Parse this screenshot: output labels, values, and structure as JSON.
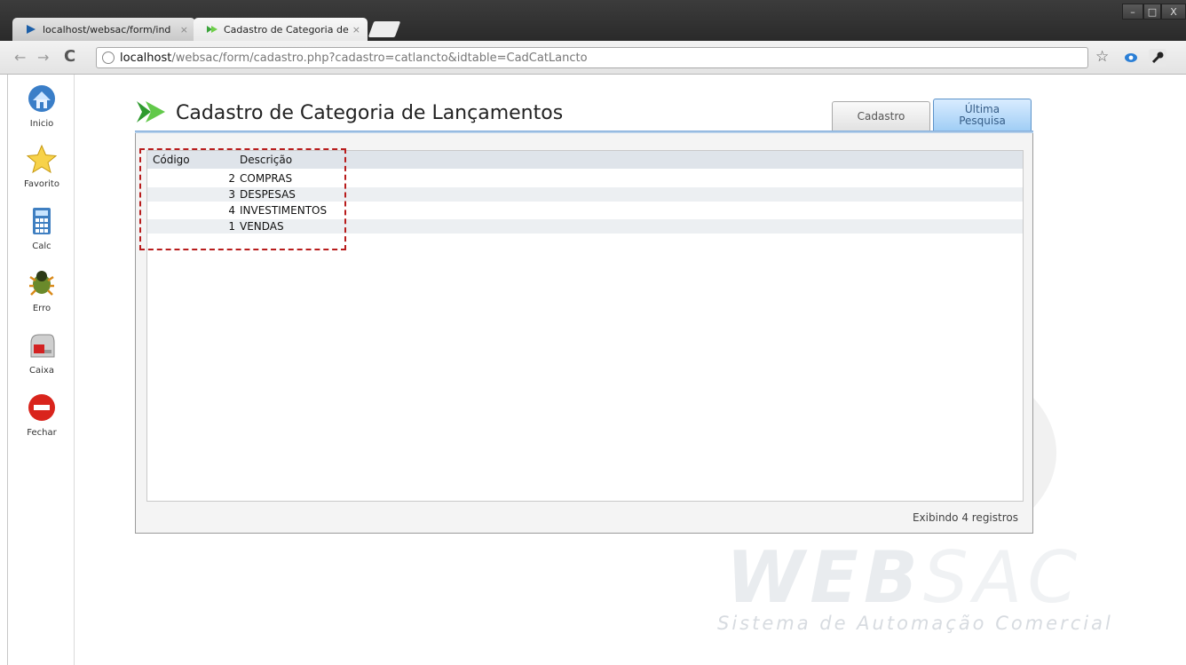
{
  "browser": {
    "tabs": [
      {
        "title": "localhost/websac/form/ind",
        "active": false
      },
      {
        "title": "Cadastro de Categoria de La",
        "active": true
      }
    ],
    "url_host": "localhost",
    "url_rest": "/websac/form/cadastro.php?cadastro=catlancto&idtable=CadCatLancto",
    "window_controls": [
      "–",
      "□",
      "X"
    ]
  },
  "sidebar": {
    "items": [
      {
        "label": "Inicio",
        "icon": "home-icon"
      },
      {
        "label": "Favorito",
        "icon": "star-icon"
      },
      {
        "label": "Calc",
        "icon": "calculator-icon"
      },
      {
        "label": "Erro",
        "icon": "bug-icon"
      },
      {
        "label": "Caixa",
        "icon": "mailbox-icon"
      },
      {
        "label": "Fechar",
        "icon": "close-icon"
      }
    ]
  },
  "page": {
    "title": "Cadastro de Categoria de Lançamentos",
    "tabs": {
      "cadastro": "Cadastro",
      "ultima_line1": "Última",
      "ultima_line2": "Pesquisa"
    },
    "columns": {
      "codigo": "Código",
      "descricao": "Descrição"
    },
    "rows": [
      {
        "codigo": "2",
        "descricao": "COMPRAS"
      },
      {
        "codigo": "3",
        "descricao": "DESPESAS"
      },
      {
        "codigo": "4",
        "descricao": "INVESTIMENTOS"
      },
      {
        "codigo": "1",
        "descricao": "VENDAS"
      }
    ],
    "footer": "Exibindo 4 registros"
  },
  "watermark": {
    "web": "WEB",
    "sac": "SAC",
    "subtitle": "Sistema de Automação Comercial"
  },
  "colors": {
    "highlight": "#b81c1c",
    "active_tab": "#9fcdf5"
  }
}
